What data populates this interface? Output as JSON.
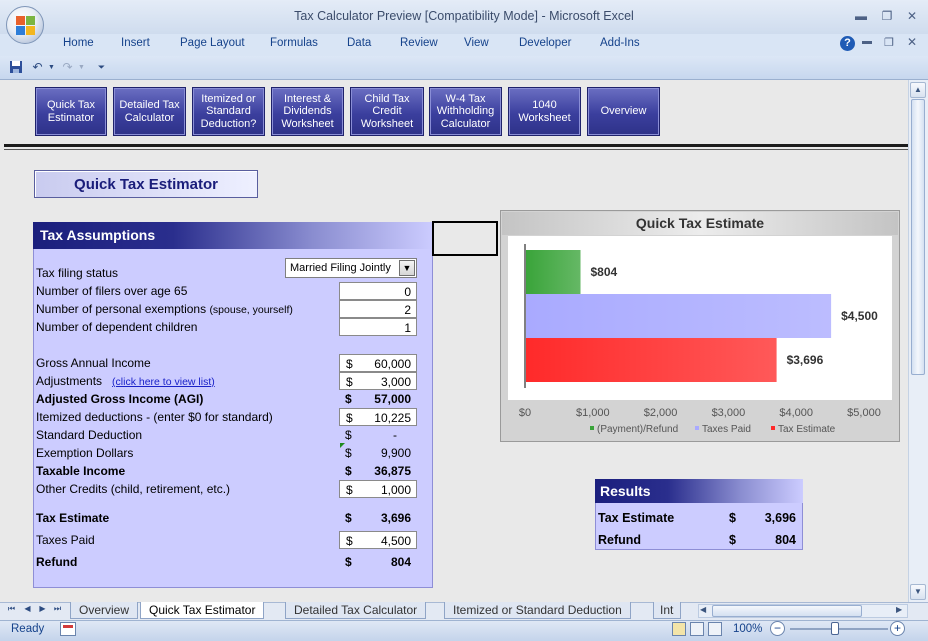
{
  "window": {
    "title": "Tax Calculator Preview  [Compatibility Mode] - Microsoft Excel",
    "minimize": "▬",
    "maximize": "❐",
    "close": "✕"
  },
  "ribbon_tabs": [
    "Home",
    "Insert",
    "Page Layout",
    "Formulas",
    "Data",
    "Review",
    "View",
    "Developer",
    "Add-Ins"
  ],
  "nav_buttons": [
    "Quick Tax Estimator",
    "Detailed Tax Calculator",
    "Itemized or Standard Deduction?",
    "Interest & Dividends Worksheet",
    "Child Tax Credit Worksheet",
    "W-4 Tax Withholding Calculator",
    "1040 Worksheet",
    "Overview"
  ],
  "page_title": "Quick Tax Estimator",
  "assumptions": {
    "header": "Tax Assumptions",
    "filing_status_label": "Tax filing status",
    "filing_status_value": "Married Filing Jointly",
    "filers_over_65_label": "Number of filers over age 65",
    "filers_over_65": "0",
    "exemptions_label": "Number of personal exemptions",
    "exemptions_note": "(spouse, yourself)",
    "exemptions": "2",
    "dependents_label": "Number of dependent children",
    "dependents": "1",
    "gross_income_label": "Gross Annual Income",
    "gross_income": "60,000",
    "adjustments_label": "Adjustments",
    "adjustments_link": "(click here to view list)",
    "adjustments": "3,000",
    "agi_label": "Adjusted Gross Income (AGI)",
    "agi": "57,000",
    "itemized_label": "Itemized deductions - (enter $0 for standard)",
    "itemized": "10,225",
    "standard_label": "Standard Deduction",
    "standard": "-",
    "exemption_dollars_label": "Exemption Dollars",
    "exemption_dollars": "9,900",
    "taxable_label": "Taxable Income",
    "taxable": "36,875",
    "other_credits_label": "Other Credits (child, retirement, etc.)",
    "other_credits": "1,000",
    "tax_estimate_label": "Tax Estimate",
    "tax_estimate": "3,696",
    "taxes_paid_label": "Taxes Paid",
    "taxes_paid": "4,500",
    "refund_label": "Refund",
    "refund": "804",
    "currency": "$"
  },
  "chart_data": {
    "type": "bar",
    "orientation": "horizontal",
    "title": "Quick Tax Estimate",
    "series": [
      {
        "name": "(Payment)/Refund",
        "value": 804,
        "label": "$804",
        "color": "#3aa43a"
      },
      {
        "name": "Taxes Paid",
        "value": 4500,
        "label": "$4,500",
        "color": "#a9aaff"
      },
      {
        "name": "Tax Estimate",
        "value": 3696,
        "label": "$3,696",
        "color": "#ff2a2a"
      }
    ],
    "xticks": [
      "$0",
      "$1,000",
      "$2,000",
      "$3,000",
      "$4,000",
      "$5,000"
    ],
    "xlim": [
      0,
      5000
    ],
    "legend_position": "bottom"
  },
  "results": {
    "header": "Results",
    "tax_estimate_label": "Tax Estimate",
    "tax_estimate": "3,696",
    "refund_label": "Refund",
    "refund": "804",
    "currency": "$"
  },
  "sheet_tabs": [
    "Overview",
    "Quick Tax Estimator",
    "Detailed Tax Calculator",
    "Itemized or Standard Deduction",
    "Int"
  ],
  "status": {
    "ready": "Ready",
    "zoom": "100%"
  }
}
